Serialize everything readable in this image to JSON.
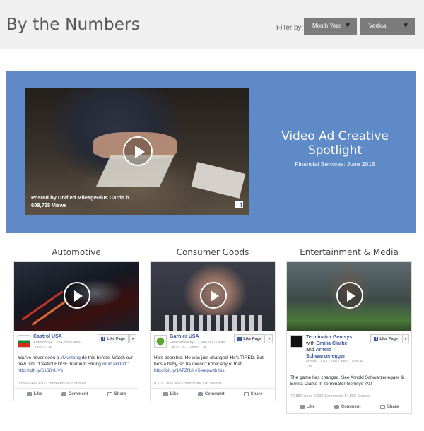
{
  "header": {
    "title": "By the Numbers",
    "filter_label": "Filter by:",
    "month_select": "Month Year",
    "vertical_select": "Vertical",
    "caret_icon": "caret-down-icon"
  },
  "hero": {
    "posted_by": "Posted by Unified MileagePlus Cards b...",
    "views": "608,725 Views",
    "fb_glyph": "f",
    "title": "Video Ad Creative Spotlight",
    "subtitle": "Financial Services: June 2015",
    "accent_color": "#5f8ac8"
  },
  "columns": [
    {
      "heading": "Automotive",
      "page_name": "Castrol USA",
      "page_meta": "Automotive · 134,888 Likes · June 3 · ⊗",
      "like_page": "Like Page",
      "text_parts": [
        "You've never seen a ",
        "#Mustang",
        " do this before. Watch our new film, \"Castrol EDGE Titanium Strong ",
        "#VirtualDrift",
        ".\" ",
        "http://gfh.ly/6168hUVs"
      ],
      "stats": "5,896 Likes   497 Comments   915 Shares",
      "actions": [
        "Like",
        "Comment",
        "Share"
      ]
    },
    {
      "heading": "Consumer Goods",
      "page_name": "Garnier USA",
      "page_meta": "Health/Beauty · 1,986,930 Likes · April 28 · Edited · ⊗",
      "like_page": "Like Page",
      "text_parts": [
        "He's been fed. He was just changed. He's TIRED. But he's a baby, so he doesn't know any of that. ",
        "http://bit.ly/1ATZf18",
        " ",
        "#Sleepwiththis"
      ],
      "stats": "8,111 Likes   432 Comments   776 Shares",
      "actions": [
        "Like",
        "Comment",
        "Share"
      ]
    },
    {
      "heading": "Entertainment & Media",
      "page_name": "Terminator Genisys",
      "page_with": "with",
      "page_name2": "Emilia Clarke",
      "page_and": "and",
      "page_name3": "Arnold Schwarzenegger",
      "page_meta": "Movie · 1,433,788 Likes · June 4 · ⊗",
      "like_page": "Like Page",
      "text_parts": [
        "The game has changed. See Arnold Schwarzenegger & Emilia Clarke in Terminator Genisys 7/1!"
      ],
      "stats": "70,882 Likes   2,605 Comments   14,826 Shares",
      "actions": [
        "Like",
        "Comment",
        "Share"
      ]
    }
  ]
}
